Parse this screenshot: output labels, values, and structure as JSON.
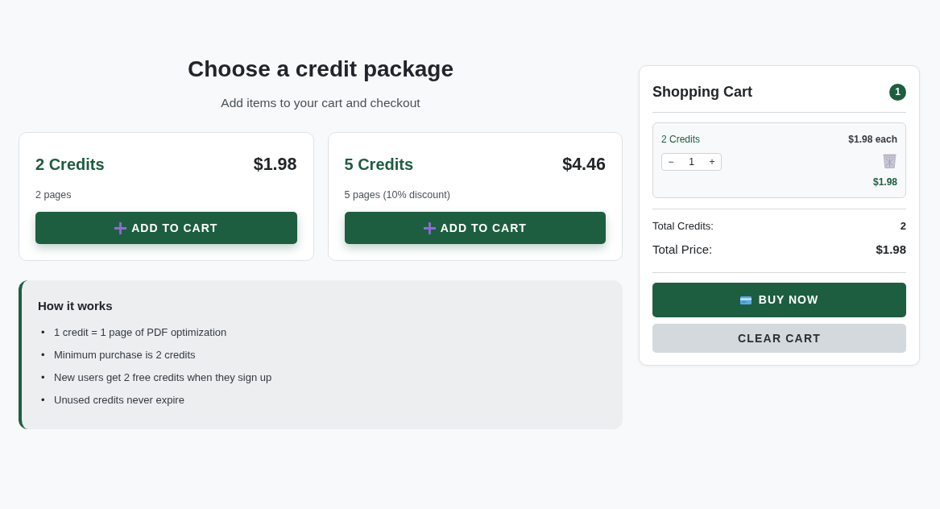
{
  "header": {
    "title": "Choose a credit package",
    "subtitle": "Add items to your cart and checkout"
  },
  "packages": [
    {
      "name": "2 Credits",
      "price": "$1.98",
      "description": "2 pages",
      "button": "ADD TO CART"
    },
    {
      "name": "5 Credits",
      "price": "$4.46",
      "description": "5 pages (10% discount)",
      "button": "ADD TO CART"
    }
  ],
  "info": {
    "title": "How it works",
    "items": [
      {
        "marker": "•",
        "text": "1 credit = 1 page of PDF optimization"
      },
      {
        "marker": "•",
        "text": "Minimum purchase is 2 credits"
      },
      {
        "marker": "•",
        "text": "New users get 2 free credits when they sign up"
      },
      {
        "marker": "•",
        "text": "Unused credits never expire"
      }
    ]
  },
  "cart": {
    "title": "Shopping Cart",
    "count": "1",
    "items": [
      {
        "name": "2 Credits",
        "unit_price": "$1.98 each",
        "decrement": "−",
        "quantity": "1",
        "increment": "+",
        "subtotal": "$1.98"
      }
    ],
    "totals": [
      {
        "kind": "minor",
        "label": "Total Credits:",
        "value": "2"
      },
      {
        "kind": "major",
        "label": "Total Price:",
        "value": "$1.98"
      }
    ],
    "buttons": [
      {
        "kind": "primary",
        "label": "BUY NOW"
      },
      {
        "kind": "secondary",
        "label": "CLEAR CART"
      }
    ]
  }
}
